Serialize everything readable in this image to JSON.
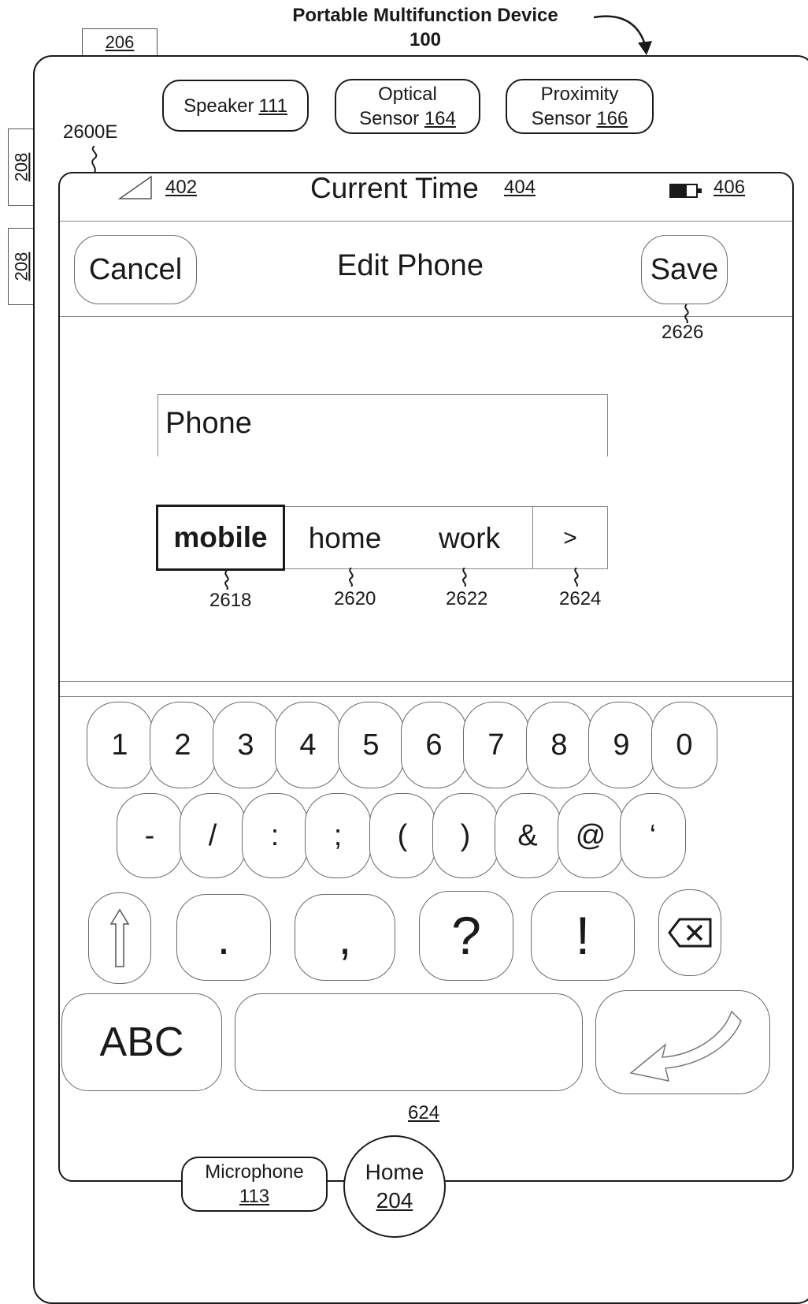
{
  "title": {
    "line1": "Portable Multifunction Device",
    "line2": "100"
  },
  "side_labels": {
    "top": "206",
    "left_upper": "208",
    "left_lower": "208"
  },
  "sensors": {
    "speaker": {
      "name": "Speaker",
      "num": "111"
    },
    "optical": {
      "line1": "Optical",
      "name": "Sensor",
      "num": "164"
    },
    "proximity": {
      "line1": "Proximity",
      "name": "Sensor",
      "num": "166"
    }
  },
  "screen_ref": "2600E",
  "status_bar": {
    "signal_ref": "402",
    "time": "Current Time",
    "time_ref": "404",
    "battery_ref": "406"
  },
  "nav": {
    "cancel": "Cancel",
    "title": "Edit Phone",
    "save": "Save",
    "save_ref": "2626"
  },
  "field": {
    "label": "Phone"
  },
  "labels": [
    {
      "text": "mobile",
      "ref": "2618",
      "selected": true
    },
    {
      "text": "home",
      "ref": "2620",
      "selected": false
    },
    {
      "text": "work",
      "ref": "2622",
      "selected": false
    },
    {
      "text": ">",
      "ref": "2624",
      "selected": false
    }
  ],
  "keyboard": {
    "row1": [
      "1",
      "2",
      "3",
      "4",
      "5",
      "6",
      "7",
      "8",
      "9",
      "0"
    ],
    "row2": [
      "-",
      "/",
      ":",
      ";",
      "(",
      ")",
      "&",
      "@",
      "‘"
    ],
    "row3": [
      ".",
      ",",
      "?",
      "!"
    ],
    "shift_icon": "shift-arrow-icon",
    "backspace_icon": "backspace-icon",
    "abc": "ABC",
    "return_icon": "return-arrow-icon",
    "ref": "624"
  },
  "hardware": {
    "microphone": {
      "name": "Microphone",
      "num": "113"
    },
    "home": {
      "name": "Home",
      "num": "204"
    }
  }
}
